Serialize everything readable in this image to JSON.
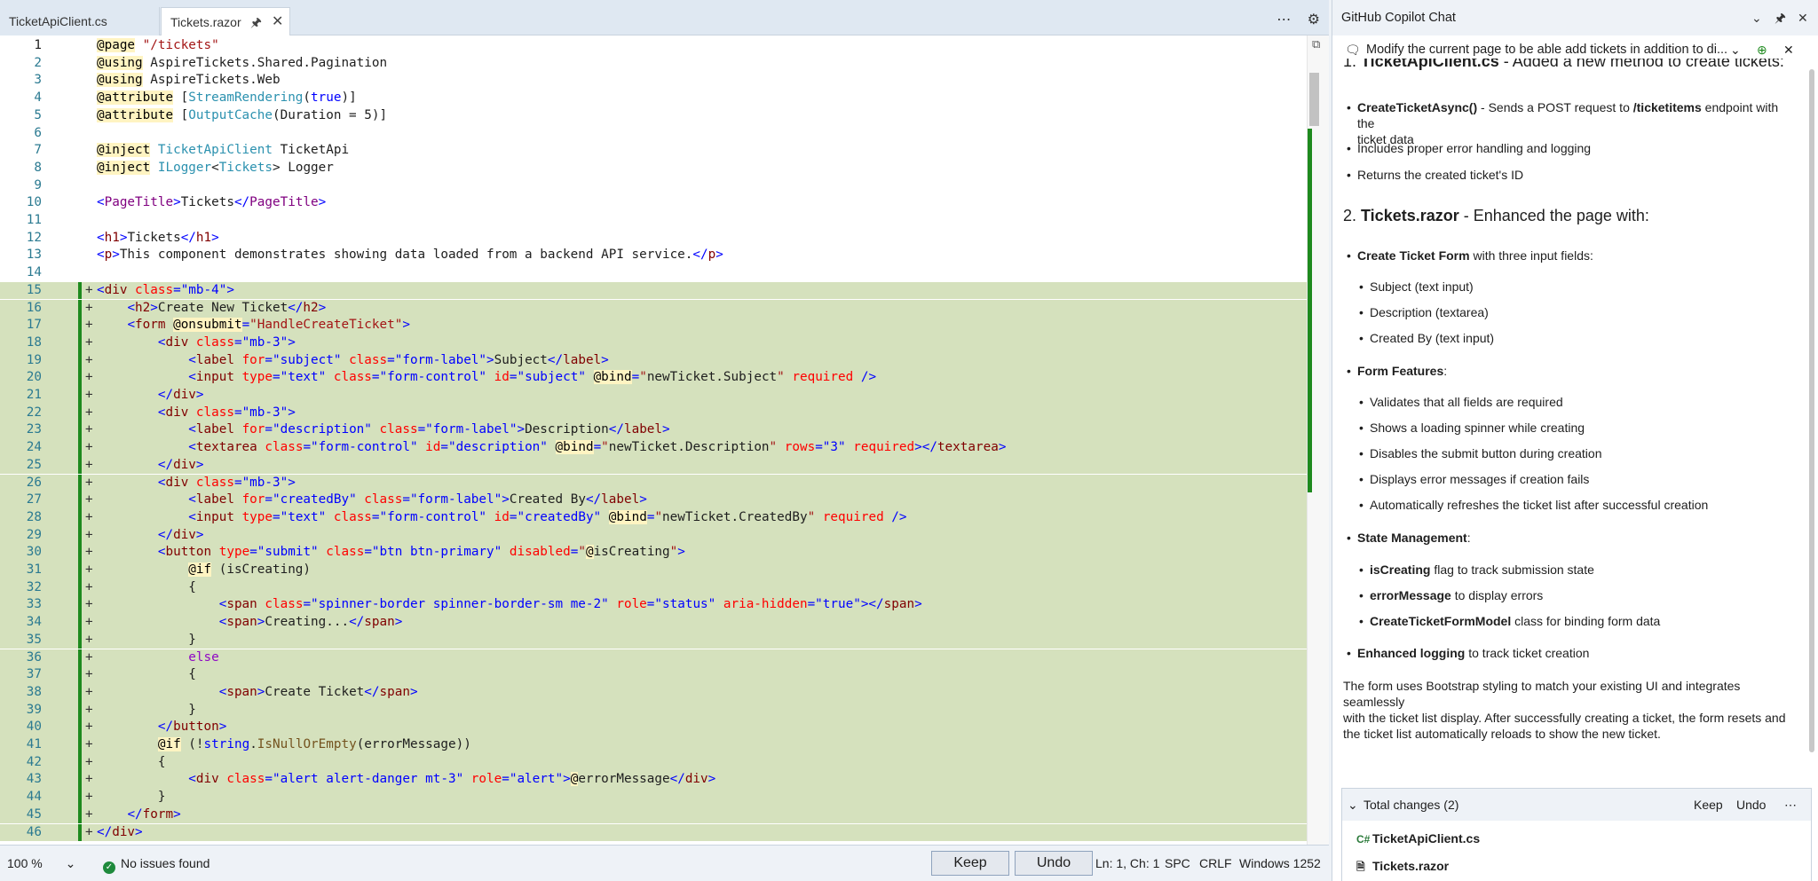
{
  "editor": {
    "tabs": [
      {
        "label": "TicketApiClient.cs"
      },
      {
        "label": "Tickets.razor"
      }
    ],
    "tab_icons": {
      "pin": "pin-icon",
      "close": "close-icon"
    },
    "toolbar_icons": {
      "more": "more-icon",
      "settings": "gear-icon",
      "split": "split-icon"
    },
    "lines": [
      {
        "n": "1",
        "add": false,
        "html": "<span class='dir'>@page</span> <span class='s'>\"/tickets\"</span>"
      },
      {
        "n": "2",
        "add": false,
        "html": "<span class='dir'>@using</span> AspireTickets.Shared.Pagination"
      },
      {
        "n": "3",
        "add": false,
        "html": "<span class='dir'>@using</span> AspireTickets.Web"
      },
      {
        "n": "4",
        "add": false,
        "html": "<span class='dir'>@attribute</span> [<span class='ty'>StreamRendering</span>(<span class='k'>true</span>)]"
      },
      {
        "n": "5",
        "add": false,
        "html": "<span class='dir'>@attribute</span> [<span class='ty'>OutputCache</span>(Duration = 5)]"
      },
      {
        "n": "6",
        "add": false,
        "html": ""
      },
      {
        "n": "7",
        "add": false,
        "html": "<span class='dir'>@inject</span> <span class='ty'>TicketApiClient</span> TicketApi"
      },
      {
        "n": "8",
        "add": false,
        "html": "<span class='dir'>@inject</span> <span class='ty'>ILogger</span>&lt;<span class='ty'>Tickets</span>&gt; Logger"
      },
      {
        "n": "9",
        "add": false,
        "html": ""
      },
      {
        "n": "10",
        "add": false,
        "html": "<span class='pu'>&lt;</span><span class='tag' style='color:#800080'>PageTitle</span><span class='pu'>&gt;</span>Tickets<span class='pu'>&lt;/</span><span class='tag' style='color:#800080'>PageTitle</span><span class='pu'>&gt;</span>"
      },
      {
        "n": "11",
        "add": false,
        "html": ""
      },
      {
        "n": "12",
        "add": false,
        "html": "<span class='pu'>&lt;</span><span class='tag'>h1</span><span class='pu'>&gt;</span>Tickets<span class='pu'>&lt;/</span><span class='tag'>h1</span><span class='pu'>&gt;</span>"
      },
      {
        "n": "13",
        "add": false,
        "html": "<span class='pu'>&lt;</span><span class='tag'>p</span><span class='pu'>&gt;</span>This component demonstrates showing data loaded from a backend API service.<span class='pu'>&lt;/</span><span class='tag'>p</span><span class='pu'>&gt;</span>"
      },
      {
        "n": "14",
        "add": false,
        "html": ""
      },
      {
        "n": "15",
        "add": true,
        "html": "<span class='pu'>&lt;</span><span class='tag'>div</span> <span class='at'>class</span><span class='pu'>=</span><span class='pu'>\"mb-4\"</span><span class='pu'>&gt;</span>"
      },
      {
        "n": "16",
        "add": true,
        "html": "    <span class='pu'>&lt;</span><span class='tag'>h2</span><span class='pu'>&gt;</span>Create New Ticket<span class='pu'>&lt;/</span><span class='tag'>h2</span><span class='pu'>&gt;</span>"
      },
      {
        "n": "17",
        "add": true,
        "html": "    <span class='pu'>&lt;</span><span class='tag'>form</span> <span class='dir'>@onsubmit</span><span class='pu'>=</span><span class='s'>\"HandleCreateTicket\"</span><span class='pu'>&gt;</span>"
      },
      {
        "n": "18",
        "add": true,
        "html": "        <span class='pu'>&lt;</span><span class='tag'>div</span> <span class='at'>class</span><span class='pu'>=\"mb-3\"&gt;</span>"
      },
      {
        "n": "19",
        "add": true,
        "html": "            <span class='pu'>&lt;</span><span class='tag'>label</span> <span class='at'>for</span><span class='pu'>=\"subject\"</span> <span class='at'>class</span><span class='pu'>=\"form-label\"&gt;</span>Subject<span class='pu'>&lt;/</span><span class='tag'>label</span><span class='pu'>&gt;</span>"
      },
      {
        "n": "20",
        "add": true,
        "html": "            <span class='pu'>&lt;</span><span class='tag'>input</span> <span class='at'>type</span><span class='pu'>=\"text\"</span> <span class='at'>class</span><span class='pu'>=\"form-control\"</span> <span class='at'>id</span><span class='pu'>=\"subject\"</span> <span class='dir'>@bind</span><span class='pu'>=</span><span class='s'>\"</span>newTicket.Subject<span class='s'>\"</span> <span class='at'>required</span> <span class='pu'>/&gt;</span>"
      },
      {
        "n": "21",
        "add": true,
        "html": "        <span class='pu'>&lt;/</span><span class='tag'>div</span><span class='pu'>&gt;</span>"
      },
      {
        "n": "22",
        "add": true,
        "html": "        <span class='pu'>&lt;</span><span class='tag'>div</span> <span class='at'>class</span><span class='pu'>=\"mb-3\"&gt;</span>"
      },
      {
        "n": "23",
        "add": true,
        "html": "            <span class='pu'>&lt;</span><span class='tag'>label</span> <span class='at'>for</span><span class='pu'>=\"description\"</span> <span class='at'>class</span><span class='pu'>=\"form-label\"&gt;</span>Description<span class='pu'>&lt;/</span><span class='tag'>label</span><span class='pu'>&gt;</span>"
      },
      {
        "n": "24",
        "add": true,
        "html": "            <span class='pu'>&lt;</span><span class='tag'>textarea</span> <span class='at'>class</span><span class='pu'>=\"form-control\"</span> <span class='at'>id</span><span class='pu'>=\"description\"</span> <span class='dir'>@bind</span><span class='pu'>=</span><span class='s'>\"</span>newTicket.Description<span class='s'>\"</span> <span class='at'>rows</span><span class='pu'>=\"3\"</span> <span class='at'>required</span><span class='pu'>&gt;&lt;/</span><span class='tag'>textarea</span><span class='pu'>&gt;</span>"
      },
      {
        "n": "25",
        "add": true,
        "html": "        <span class='pu'>&lt;/</span><span class='tag'>div</span><span class='pu'>&gt;</span>"
      },
      {
        "n": "26",
        "add": true,
        "html": "        <span class='pu'>&lt;</span><span class='tag'>div</span> <span class='at'>class</span><span class='pu'>=\"mb-3\"&gt;</span>"
      },
      {
        "n": "27",
        "add": true,
        "html": "            <span class='pu'>&lt;</span><span class='tag'>label</span> <span class='at'>for</span><span class='pu'>=\"createdBy\"</span> <span class='at'>class</span><span class='pu'>=\"form-label\"&gt;</span>Created By<span class='pu'>&lt;/</span><span class='tag'>label</span><span class='pu'>&gt;</span>"
      },
      {
        "n": "28",
        "add": true,
        "html": "            <span class='pu'>&lt;</span><span class='tag'>input</span> <span class='at'>type</span><span class='pu'>=\"text\"</span> <span class='at'>class</span><span class='pu'>=\"form-control\"</span> <span class='at'>id</span><span class='pu'>=\"createdBy\"</span> <span class='dir'>@bind</span><span class='pu'>=</span><span class='s'>\"</span>newTicket.CreatedBy<span class='s'>\"</span> <span class='at'>required</span> <span class='pu'>/&gt;</span>"
      },
      {
        "n": "29",
        "add": true,
        "html": "        <span class='pu'>&lt;/</span><span class='tag'>div</span><span class='pu'>&gt;</span>"
      },
      {
        "n": "30",
        "add": true,
        "html": "        <span class='pu'>&lt;</span><span class='tag'>button</span> <span class='at'>type</span><span class='pu'>=\"submit\"</span> <span class='at'>class</span><span class='pu'>=\"btn btn-primary\"</span> <span class='at'>disabled</span><span class='pu'>=</span><span class='s'>\"</span><span class='dir'>@</span>isCreating<span class='s'>\"</span><span class='pu'>&gt;</span>"
      },
      {
        "n": "31",
        "add": true,
        "html": "            <span class='dir'>@if</span> (isCreating)"
      },
      {
        "n": "32",
        "add": true,
        "html": "            {"
      },
      {
        "n": "33",
        "add": true,
        "html": "                <span class='pu'>&lt;</span><span class='tag'>span</span> <span class='at'>class</span><span class='pu'>=\"spinner-border spinner-border-sm me-2\"</span> <span class='at'>role</span><span class='pu'>=\"status\"</span> <span class='at'>aria-hidden</span><span class='pu'>=\"true\"&gt;&lt;/</span><span class='tag'>span</span><span class='pu'>&gt;</span>"
      },
      {
        "n": "34",
        "add": true,
        "html": "                <span class='pu'>&lt;</span><span class='tag'>span</span><span class='pu'>&gt;</span>Creating...<span class='pu'>&lt;/</span><span class='tag'>span</span><span class='pu'>&gt;</span>"
      },
      {
        "n": "35",
        "add": true,
        "html": "            }"
      },
      {
        "n": "36",
        "add": true,
        "html": "            <span class='tag' style='color:#8f08c4'>else</span>"
      },
      {
        "n": "37",
        "add": true,
        "html": "            {"
      },
      {
        "n": "38",
        "add": true,
        "html": "                <span class='pu'>&lt;</span><span class='tag'>span</span><span class='pu'>&gt;</span>Create Ticket<span class='pu'>&lt;/</span><span class='tag'>span</span><span class='pu'>&gt;</span>"
      },
      {
        "n": "39",
        "add": true,
        "html": "            }"
      },
      {
        "n": "40",
        "add": true,
        "html": "        <span class='pu'>&lt;/</span><span class='tag'>button</span><span class='pu'>&gt;</span>"
      },
      {
        "n": "41",
        "add": true,
        "html": "        <span class='dir'>@if</span> (!<span class='k'>string</span>.<span class='tag' style='color:#74531f'>IsNullOrEmpty</span>(errorMessage))"
      },
      {
        "n": "42",
        "add": true,
        "html": "        {"
      },
      {
        "n": "43",
        "add": true,
        "html": "            <span class='pu'>&lt;</span><span class='tag'>div</span> <span class='at'>class</span><span class='pu'>=\"alert alert-danger mt-3\"</span> <span class='at'>role</span><span class='pu'>=\"alert\"&gt;</span><span class='dir'>@</span>errorMessage<span class='pu'>&lt;/</span><span class='tag'>div</span><span class='pu'>&gt;</span>"
      },
      {
        "n": "44",
        "add": true,
        "html": "        }"
      },
      {
        "n": "45",
        "add": true,
        "html": "    <span class='pu'>&lt;/</span><span class='tag'>form</span><span class='pu'>&gt;</span>"
      },
      {
        "n": "46",
        "add": true,
        "html": "<span class='pu'>&lt;/</span><span class='tag'>div</span><span class='pu'>&gt;</span>"
      }
    ]
  },
  "statusbar": {
    "zoom": "100 %",
    "issues": "No issues found",
    "keep": "Keep",
    "undo": "Undo",
    "position": "Ln: 1, Ch: 1",
    "whitespace": "SPC",
    "eol": "CRLF",
    "encoding": "Windows 1252"
  },
  "chat": {
    "title": "GitHub Copilot Chat",
    "prompt": "Modify the current page to be able add tickets in addition to di...",
    "heading1_num": "1. ",
    "heading1_file": "TicketApiClient.cs",
    "heading1_rest": " - Added a new method to create tickets:",
    "b1_bold": "CreateTicketAsync()",
    "b1_text": " - Sends a POST request to ",
    "b1_bold2": "/ticketitems",
    "b1_text2": " endpoint with the",
    "b1_text3": "ticket data",
    "b2": "Includes proper error handling and logging",
    "b3": "Returns the created ticket's ID",
    "heading2_num": "2. ",
    "heading2_file": "Tickets.razor",
    "heading2_rest": " - Enhanced the page with:",
    "f_bold": "Create Ticket Form",
    "f_text": " with three input fields:",
    "f1": "Subject (text input)",
    "f2": "Description (textarea)",
    "f3": "Created By (text input)",
    "ff_bold": "Form Features",
    "ff_colon": ":",
    "ff1": "Validates that all fields are required",
    "ff2": "Shows a loading spinner while creating",
    "ff3": "Disables the submit button during creation",
    "ff4": "Displays error messages if creation fails",
    "ff5": "Automatically refreshes the ticket list after successful creation",
    "sm_bold": "State Management",
    "sm_colon": ":",
    "sm1_bold": "isCreating",
    "sm1_text": " flag to track submission state",
    "sm2_bold": "errorMessage",
    "sm2_text": " to display errors",
    "sm3_bold": "CreateTicketFormModel",
    "sm3_text": " class for binding form data",
    "el_bold": "Enhanced logging",
    "el_text": " to track ticket creation",
    "summary1": "The form uses Bootstrap styling to match your existing UI and integrates seamlessly",
    "summary2": "with the ticket list display. After successfully creating a ticket, the form resets and",
    "summary3": "the ticket list automatically reloads to show the new ticket.",
    "changes_title": "Total changes (2)",
    "changes_keep": "Keep",
    "changes_undo": "Undo",
    "changed_files": [
      "TicketApiClient.cs",
      "Tickets.razor"
    ]
  },
  "colors": {
    "added_bg": "#d5e1bd",
    "added_bar": "#1e8a1e",
    "accent": "#0b5cad"
  }
}
